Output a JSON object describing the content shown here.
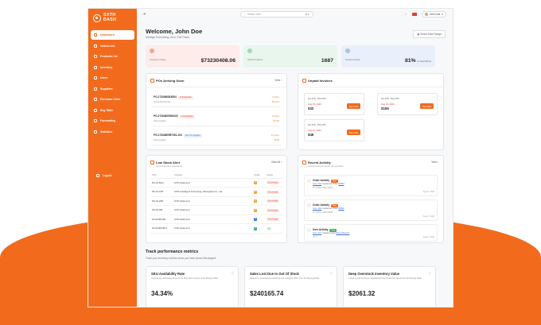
{
  "app": {
    "logo_line1": "SXTH",
    "logo_line2": "DASH"
  },
  "sidebar": {
    "items": [
      {
        "label": "Dashboard",
        "icon": "grid-icon",
        "active": true
      },
      {
        "label": "Orders List",
        "icon": "list-icon"
      },
      {
        "label": "Products List",
        "icon": "box-icon"
      },
      {
        "label": "Inventory",
        "icon": "warehouse-icon"
      },
      {
        "label": "Users",
        "icon": "users-icon"
      },
      {
        "label": "Suppliers",
        "icon": "truck-icon"
      },
      {
        "label": "Purchase Order",
        "icon": "cart-icon"
      },
      {
        "label": "Buy Table",
        "icon": "table-icon"
      },
      {
        "label": "Forecasting",
        "icon": "chart-icon"
      },
      {
        "label": "Statistics",
        "icon": "stats-icon"
      }
    ],
    "logout": "Logout"
  },
  "topbar": {
    "search_placeholder": "Search here",
    "search_kbd": "⌘ K",
    "user_name": "John Doe"
  },
  "welcome": {
    "title": "Welcome, John Doe",
    "subtitle": "Manage Everything, All in One Place."
  },
  "date_range": "Select Date Range",
  "stats": [
    {
      "label": "Inventory Value",
      "value": "$73230408.06",
      "sub": "",
      "bg": "#fdecea",
      "icon_color": "#f4a59a"
    },
    {
      "label": "Total Products",
      "value": "1687",
      "sub": "",
      "bg": "#e8f6ee",
      "icon_color": "#9fd9b5"
    },
    {
      "label": "Stockout Risk",
      "value": "81%",
      "sub": "of total SKUs",
      "bg": "#e9f0fb",
      "icon_color": "#a7c2ee"
    }
  ],
  "pos_card": {
    "title": "POs Arriving Soon",
    "action": "View",
    "rows": [
      {
        "id": "PO-1732480818254",
        "badge": "In Production",
        "badge_bg": "#fde8e6",
        "badge_color": "#e23b2e",
        "supplier": "Group Enterprise",
        "days": "5 Days",
        "amount": "$54121"
      },
      {
        "id": "PO-17324820533415",
        "badge": "In Production",
        "badge_bg": "#fde8e6",
        "badge_color": "#e23b2e",
        "supplier": "Test supplier",
        "days": "8 Days",
        "amount": "$1706"
      },
      {
        "id": "PO-17324809R7261-104",
        "badge": "Sent To Supplier",
        "badge_bg": "#e6ecfd",
        "badge_color": "#3b6fd8",
        "supplier": "Test supplier",
        "days": "11 Days",
        "amount": "$600"
      }
    ]
  },
  "invoices_card": {
    "title": "Unpaid Invoices",
    "items": [
      {
        "id": "Inv-173... PO-173...",
        "date": "Aug 06, 2024",
        "amount": "$32",
        "button": "Pay Now"
      },
      {
        "id": "Inv-173... PO-173...",
        "date": "Aug 19, 2024",
        "amount": "$155",
        "button": "Pay Now"
      },
      {
        "id": "Inv-173... PO-173...",
        "date": "Aug 22, 2024",
        "amount": "$46",
        "button": "Pay Now"
      }
    ]
  },
  "lowstock_card": {
    "title": "Low Stock Alert",
    "subtitle": "Items that need restocking",
    "action": "View All",
    "columns": [
      "SKU",
      "Supplier",
      "Grade",
      "Status"
    ],
    "rows": [
      {
        "sku": "DS-15-5GN",
        "supplier": "SXTH Diamond",
        "grade": "A",
        "grade_color": "#f0a23a",
        "status": "Out of stock"
      },
      {
        "sku": "DS-15-10B",
        "supplier": "SXTH Intelligent Technology (Shanghai) Co., Ltd.",
        "grade": "A",
        "grade_color": "#f0a23a",
        "status": "Out of stock"
      },
      {
        "sku": "DS-15-20B",
        "supplier": "SXTH Diamond",
        "grade": "A",
        "grade_color": "#f0a23a",
        "status": "Out of stock"
      },
      {
        "sku": "DS-15-4IB",
        "supplier": "SXTH Diamond",
        "grade": "A",
        "grade_color": "#f0a23a",
        "status": "Out of stock"
      },
      {
        "sku": "18-18-800-BG",
        "supplier": "SXTH Diamond",
        "grade": "B",
        "grade_color": "#3b6fd8",
        "status": "Out of stock"
      },
      {
        "sku": "18-18-800-BLK",
        "supplier": "SXTH Diamond",
        "grade": "C",
        "grade_color": "#3bb26b",
        "status": "OK"
      }
    ]
  },
  "activity_card": {
    "title": "Recent Activity",
    "subtitle": "Latest business events and updates",
    "action": "View",
    "items": [
      {
        "title": "Order Activity",
        "tag": "New",
        "tag_color": "#f26b1d",
        "desc_prefix": "",
        "link": "Jerry Joel",
        "desc_suffix": " created an Order ",
        "link2": "#1893",
        "sub": "ID: 1656-6-8097-8694",
        "time": "Aug 27, 2024"
      },
      {
        "title": "Order Activity",
        "tag": "New",
        "tag_color": "#f26b1d",
        "desc_prefix": "",
        "link": "Jerry Joel",
        "desc_suffix": " created an Order ",
        "link2": "#1892",
        "sub": "ID: 1656-6-8097-8693",
        "time": "Aug 27, 2024"
      },
      {
        "title": "User Activity",
        "tag": "New",
        "tag_color": "#3bb26b",
        "desc_prefix": "",
        "link": "Jerry Joel",
        "desc_suffix": " created a user ",
        "link2": "Danny Bouche",
        "sub": "ID: 1",
        "time": "Aug 27, 2024"
      }
    ]
  },
  "performance": {
    "title": "Track performance metrics",
    "subtitle": "Track your inventory metrics since you have joined Stockagent.",
    "metrics": [
      {
        "title": "SKU Availability Rate",
        "desc": "Improve by purchasing items in the 'Buy Now' section of the Buying Table",
        "value": "34.34%"
      },
      {
        "title": "Sales Lost Due to Out Of Stock",
        "desc": "Reduce by purchasing restocking of A category SKUs from the Buying Table",
        "value": "$240165.74"
      },
      {
        "title": "Deep Overstock Inventory Value",
        "desc": "Lower by discounting or liquidating Deep Overstock Stock from the Buying Table",
        "value": "$2061.32"
      }
    ]
  }
}
